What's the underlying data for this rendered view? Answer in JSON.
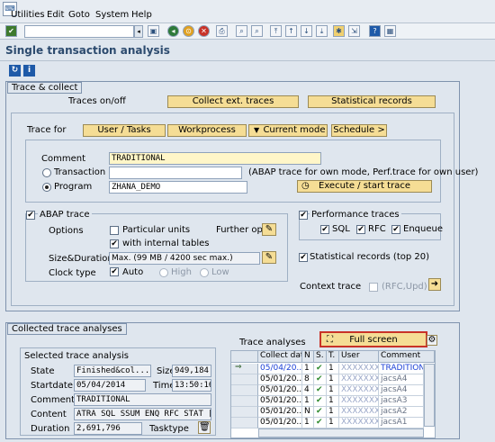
{
  "menu": [
    "Utilities",
    "Edit",
    "Goto",
    "System",
    "Help"
  ],
  "screen_title": "Single transaction analysis",
  "trace_collect": {
    "group_title": "Trace & collect",
    "traces_onoff_label": "Traces on/off",
    "collect_ext_traces": "Collect ext. traces",
    "statistical_records_btn": "Statistical records",
    "trace_for_label": "Trace for",
    "tabs": [
      "User / Tasks",
      "Workprocess",
      "Current mode",
      "Schedule >"
    ],
    "comment_label": "Comment",
    "comment_value": "TRADITIONAL",
    "transaction_label": "Transaction",
    "transaction_value": "",
    "hint": "(ABAP trace for own mode, Perf.trace for own user)",
    "program_label": "Program",
    "program_value": "ZHANA_DEMO",
    "execute_btn": "Execute / start trace",
    "abap_trace": {
      "title": "ABAP trace",
      "options_label": "Options",
      "particular_units": "Particular units",
      "further_opt": "Further opt.",
      "with_internal_tables": "with internal tables",
      "size_duration_label": "Size&Duration",
      "size_duration_value": "Max. (99 MB / 4200 sec max.)",
      "clock_type_label": "Clock type",
      "auto": "Auto",
      "high": "High",
      "low": "Low"
    },
    "performance_traces": {
      "title": "Performance traces",
      "sql": "SQL",
      "rfc": "RFC",
      "enqueue": "Enqueue",
      "statistical_records": "Statistical records (top 20)",
      "context_trace": "Context trace",
      "rfc_upd": "(RFC,Upd)"
    }
  },
  "collected": {
    "group_title": "Collected trace analyses",
    "selected": {
      "title": "Selected trace analysis",
      "state_label": "State",
      "state_value": "Finished&col...",
      "size_label": "Size",
      "size_value": "949,184",
      "startdate_label": "Startdate",
      "startdate_value": "05/04/2014",
      "time_label": "Time",
      "time_value": "13:50:16",
      "comment_label": "Comment",
      "comment_value": "TRADITIONAL",
      "content_label": "Content",
      "content_value": "ATRA SQL SSUM ENQ RFC STAT [ R...",
      "duration_label": "Duration",
      "duration_value": "2,691,796",
      "tasktype_label": "Tasktype"
    },
    "analyses": {
      "label": "Trace analyses",
      "full_screen": "Full screen",
      "columns": [
        "Collect date",
        "N",
        "S.",
        "T.",
        "User",
        "Comment"
      ],
      "rows": [
        {
          "date": "05/04/20..",
          "n": "1",
          "s": "✔",
          "t": "1",
          "user": "XXXXXXXX",
          "comment": "TRADITIONAL"
        },
        {
          "date": "05/01/20..",
          "n": "8",
          "s": "✔",
          "t": "1",
          "user": "XXXXXXX",
          "comment": "jacsA4"
        },
        {
          "date": "05/01/20..",
          "n": "4",
          "s": "✔",
          "t": "1",
          "user": "XXXXXXX",
          "comment": "jacsA4"
        },
        {
          "date": "05/01/20..",
          "n": "1",
          "s": "✔",
          "t": "1",
          "user": "XXXXXXX",
          "comment": "jacsA3"
        },
        {
          "date": "05/01/20..",
          "n": "N",
          "s": "✔",
          "t": "1",
          "user": "XXXXXXX",
          "comment": "jacsA2"
        },
        {
          "date": "05/01/20..",
          "n": "1",
          "s": "✔",
          "t": "1",
          "user": "XXXXXXX",
          "comment": "jacsA1"
        }
      ]
    }
  }
}
